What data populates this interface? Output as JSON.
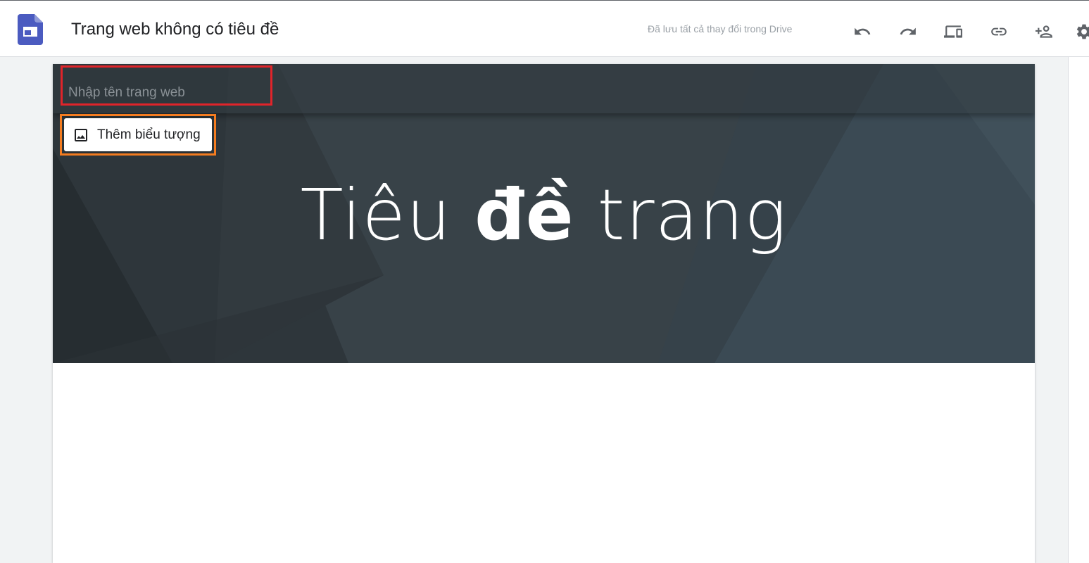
{
  "app": {
    "logo_icon": "google-sites-icon",
    "brand_color": "#4b5bc0",
    "document_title": "Trang web không có tiêu đề",
    "save_status": "Đã lưu tất cả thay đổi trong Drive"
  },
  "toolbar": {
    "icons": [
      "undo-icon",
      "redo-icon",
      "preview-devices-icon",
      "link-icon",
      "share-add-person-icon",
      "settings-gear-icon"
    ]
  },
  "site_header": {
    "site_name_placeholder": "Nhập tên trang web",
    "site_name_value": "",
    "add_logo_label": "Thêm biểu tượng",
    "add_logo_icon": "image-icon",
    "page_title_part1": "Tiêu ",
    "page_title_bold": "đề",
    "page_title_part2": " trang",
    "highlight_colors": {
      "site_name_box": "#e0242a",
      "add_logo_box": "#f47c20"
    }
  }
}
